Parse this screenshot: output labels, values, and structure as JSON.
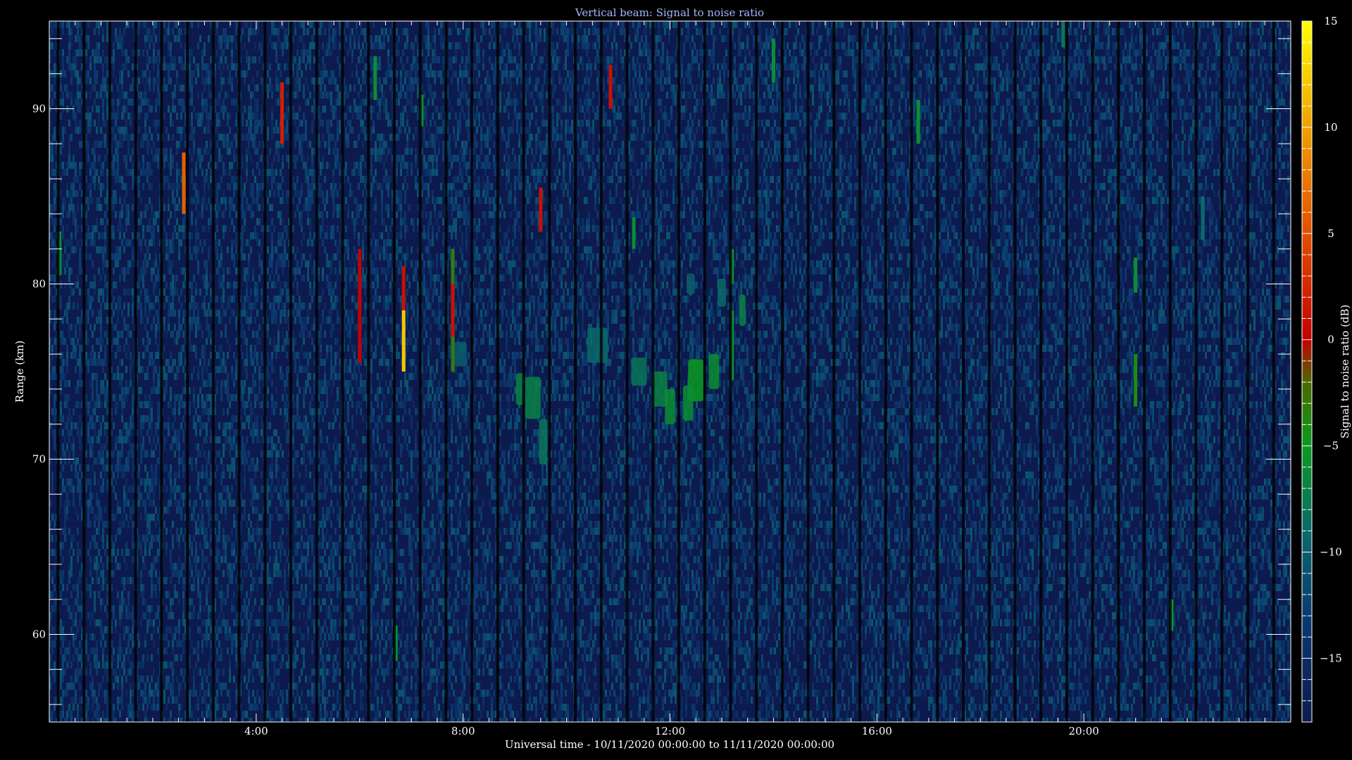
{
  "chart_data": {
    "type": "heatmap",
    "title": "Vertical beam: Signal to noise ratio",
    "xlabel": "Universal time - 10/11/2020 00:00:00 to 11/11/2020 00:00:00",
    "ylabel": "Range (km)",
    "colorbar_label": "Signal to noise ratio (dB)",
    "x_range_hours": [
      0,
      24
    ],
    "y_range_km": [
      55,
      95
    ],
    "z_range_db": [
      -18,
      15
    ],
    "x_ticks": [
      {
        "hour": 4,
        "label": "4:00"
      },
      {
        "hour": 8,
        "label": "8:00"
      },
      {
        "hour": 12,
        "label": "12:00"
      },
      {
        "hour": 16,
        "label": "16:00"
      },
      {
        "hour": 20,
        "label": "20:00"
      }
    ],
    "y_ticks": [
      {
        "km": 60,
        "label": "60"
      },
      {
        "km": 70,
        "label": "70"
      },
      {
        "km": 80,
        "label": "80"
      },
      {
        "km": 90,
        "label": "90"
      }
    ],
    "colorbar_ticks": [
      {
        "db": 15,
        "label": "15"
      },
      {
        "db": 10,
        "label": "10"
      },
      {
        "db": 5,
        "label": "5"
      },
      {
        "db": 0,
        "label": "0"
      },
      {
        "db": -5,
        "label": "−5"
      },
      {
        "db": -10,
        "label": "−10"
      },
      {
        "db": -15,
        "label": "−15"
      }
    ],
    "background_snr_db": -15,
    "colorscale": [
      {
        "db": -18,
        "color": "#0d1a4d"
      },
      {
        "db": -13,
        "color": "#0b3a70"
      },
      {
        "db": -9,
        "color": "#0a6a6a"
      },
      {
        "db": -5,
        "color": "#0a9a20"
      },
      {
        "db": -2,
        "color": "#4a6a00"
      },
      {
        "db": 0,
        "color": "#c40000"
      },
      {
        "db": 5,
        "color": "#e25000"
      },
      {
        "db": 10,
        "color": "#f0a000"
      },
      {
        "db": 15,
        "color": "#ffff00"
      }
    ],
    "echoes": [
      {
        "hour": 0.2,
        "km_min": 80.5,
        "km_max": 83.0,
        "snr_db": -6
      },
      {
        "hour": 2.6,
        "km_min": 84.0,
        "km_max": 87.5,
        "snr_db": 6
      },
      {
        "hour": 4.5,
        "km_min": 88.0,
        "km_max": 91.5,
        "snr_db": 2
      },
      {
        "hour": 6.0,
        "km_min": 75.5,
        "km_max": 82.0,
        "snr_db": 0
      },
      {
        "hour": 6.3,
        "km_min": 90.5,
        "km_max": 93.0,
        "snr_db": -6
      },
      {
        "hour": 6.7,
        "km_min": 58.5,
        "km_max": 60.5,
        "snr_db": -6
      },
      {
        "hour": 6.85,
        "km_min": 75.0,
        "km_max": 78.5,
        "snr_db": 12
      },
      {
        "hour": 6.85,
        "km_min": 78.5,
        "km_max": 81.0,
        "snr_db": 1
      },
      {
        "hour": 7.2,
        "km_min": 89.0,
        "km_max": 90.8,
        "snr_db": -6
      },
      {
        "hour": 7.8,
        "km_min": 75.0,
        "km_max": 82.0,
        "snr_db": -3
      },
      {
        "hour": 7.8,
        "km_min": 77.0,
        "km_max": 80.0,
        "snr_db": 1
      },
      {
        "hour": 9.5,
        "km_min": 83.0,
        "km_max": 85.5,
        "snr_db": 1
      },
      {
        "hour": 10.85,
        "km_min": 90.0,
        "km_max": 92.5,
        "snr_db": 1
      },
      {
        "hour": 11.3,
        "km_min": 82.0,
        "km_max": 83.8,
        "snr_db": -6
      },
      {
        "hour": 13.2,
        "km_min": 80.0,
        "km_max": 82.0,
        "snr_db": -6
      },
      {
        "hour": 13.2,
        "km_min": 74.5,
        "km_max": 78.5,
        "snr_db": -6
      },
      {
        "hour": 14.0,
        "km_min": 91.5,
        "km_max": 94.0,
        "snr_db": -6
      },
      {
        "hour": 16.8,
        "km_min": 88.0,
        "km_max": 90.5,
        "snr_db": -6
      },
      {
        "hour": 19.6,
        "km_min": 93.5,
        "km_max": 95.0,
        "snr_db": -8
      },
      {
        "hour": 21.0,
        "km_min": 79.5,
        "km_max": 81.5,
        "snr_db": -6
      },
      {
        "hour": 21.0,
        "km_min": 73.0,
        "km_max": 76.0,
        "snr_db": -4
      },
      {
        "hour": 21.7,
        "km_min": 60.2,
        "km_max": 62.0,
        "snr_db": -6
      },
      {
        "hour": 22.3,
        "km_min": 82.5,
        "km_max": 85.0,
        "snr_db": -9
      }
    ],
    "patches": [
      {
        "hour": 9.1,
        "km": 74.0,
        "hour_half_width": 0.08,
        "km_half_height": 0.9,
        "snr_db": -7
      },
      {
        "hour": 9.35,
        "km": 73.5,
        "hour_half_width": 0.15,
        "km_half_height": 1.2,
        "snr_db": -7
      },
      {
        "hour": 9.55,
        "km": 71.0,
        "hour_half_width": 0.08,
        "km_half_height": 1.3,
        "snr_db": -8
      },
      {
        "hour": 10.6,
        "km": 76.5,
        "hour_half_width": 0.2,
        "km_half_height": 1.0,
        "snr_db": -9
      },
      {
        "hour": 11.4,
        "km": 75.0,
        "hour_half_width": 0.15,
        "km_half_height": 0.8,
        "snr_db": -8
      },
      {
        "hour": 11.8,
        "km": 74.0,
        "hour_half_width": 0.15,
        "km_half_height": 1.0,
        "snr_db": -7
      },
      {
        "hour": 12.0,
        "km": 73.0,
        "hour_half_width": 0.1,
        "km_half_height": 1.0,
        "snr_db": -6
      },
      {
        "hour": 12.5,
        "km": 74.5,
        "hour_half_width": 0.15,
        "km_half_height": 1.2,
        "snr_db": -5
      },
      {
        "hour": 12.35,
        "km": 73.2,
        "hour_half_width": 0.1,
        "km_half_height": 1.0,
        "snr_db": -6
      },
      {
        "hour": 12.85,
        "km": 75.0,
        "hour_half_width": 0.1,
        "km_half_height": 1.0,
        "snr_db": -6
      },
      {
        "hour": 13.0,
        "km": 79.5,
        "hour_half_width": 0.08,
        "km_half_height": 0.8,
        "snr_db": -9
      },
      {
        "hour": 13.4,
        "km": 78.5,
        "hour_half_width": 0.06,
        "km_half_height": 0.9,
        "snr_db": -7
      },
      {
        "hour": 7.95,
        "km": 76.0,
        "hour_half_width": 0.12,
        "km_half_height": 0.7,
        "snr_db": -10
      },
      {
        "hour": 12.4,
        "km": 80.0,
        "hour_half_width": 0.08,
        "km_half_height": 0.6,
        "snr_db": -10
      }
    ]
  }
}
